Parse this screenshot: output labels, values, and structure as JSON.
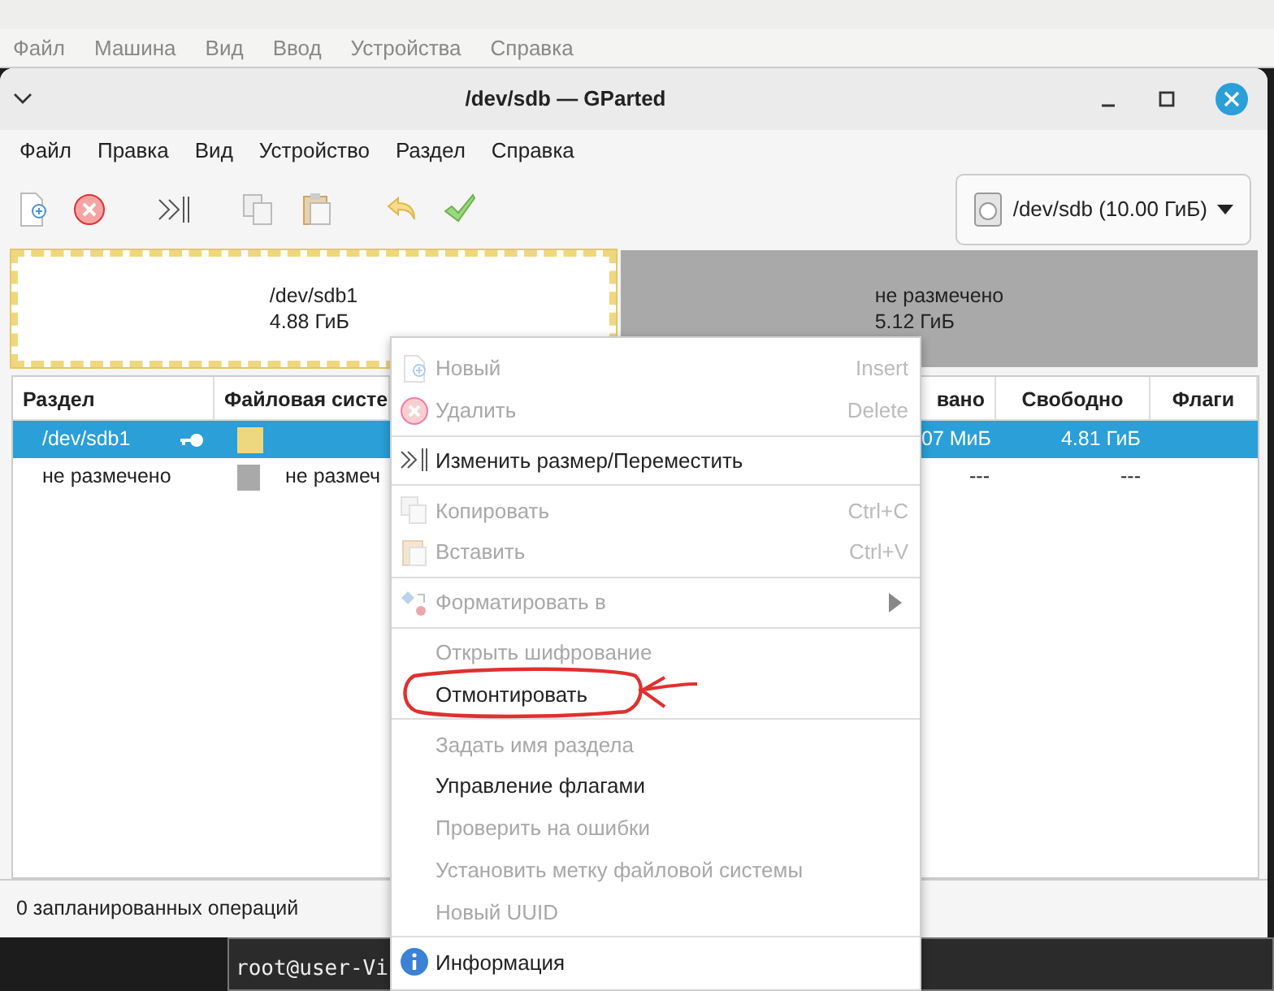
{
  "host_menu": [
    {
      "label": "Файл"
    },
    {
      "label": "Машина"
    },
    {
      "label": "Вид"
    },
    {
      "label": "Ввод"
    },
    {
      "label": "Устройства"
    },
    {
      "label": "Справка"
    }
  ],
  "window": {
    "title": "/dev/sdb — GParted"
  },
  "menu": [
    {
      "label": "Файл"
    },
    {
      "label": "Правка"
    },
    {
      "label": "Вид"
    },
    {
      "label": "Устройство"
    },
    {
      "label": "Раздел"
    },
    {
      "label": "Справка"
    }
  ],
  "device": {
    "label": "/dev/sdb (10.00 ГиБ)"
  },
  "disk_map": [
    {
      "kind": "partition",
      "name": "/dev/sdb1",
      "size": "4.88 ГиБ",
      "selected": true
    },
    {
      "kind": "unallocated",
      "name": "не размечено",
      "size": "5.12 ГиБ",
      "selected": false
    }
  ],
  "table": {
    "columns": [
      "Раздел",
      "Файловая систе",
      "вано",
      "Свободно",
      "Флаги"
    ],
    "rows": [
      {
        "partition": "/dev/sdb1",
        "mounted": true,
        "color": "#efd77f",
        "filesystem": "",
        "used": "07 МиБ",
        "free": "4.81 ГиБ",
        "selected": true
      },
      {
        "partition": "не размечено",
        "mounted": false,
        "color": "#a9a9a9",
        "filesystem": "не размеч",
        "used": "---",
        "free": "---",
        "selected": false
      }
    ]
  },
  "status_bar": "0 запланированных операций",
  "terminal": {
    "text": "root@user-Vi"
  },
  "context_menu": [
    {
      "kind": "item",
      "label": "Новый",
      "shortcut": "Insert",
      "disabled": true
    },
    {
      "kind": "item",
      "label": "Удалить",
      "shortcut": "Delete",
      "disabled": true
    },
    {
      "kind": "separator"
    },
    {
      "kind": "item",
      "label": "Изменить размер/Переместить",
      "disabled": false
    },
    {
      "kind": "separator"
    },
    {
      "kind": "item",
      "label": "Копировать",
      "shortcut": "Ctrl+C",
      "disabled": true
    },
    {
      "kind": "item",
      "label": "Вставить",
      "shortcut": "Ctrl+V",
      "disabled": true
    },
    {
      "kind": "separator"
    },
    {
      "kind": "item",
      "label": "Форматировать в",
      "disabled": true,
      "submenu": true
    },
    {
      "kind": "separator"
    },
    {
      "kind": "item",
      "label": "Открыть шифрование",
      "disabled": true
    },
    {
      "kind": "item",
      "label": "Отмонтировать",
      "disabled": false,
      "highlighted": true
    },
    {
      "kind": "separator"
    },
    {
      "kind": "item",
      "label": "Задать имя раздела",
      "disabled": true
    },
    {
      "kind": "item",
      "label": "Управление флагами",
      "disabled": false
    },
    {
      "kind": "item",
      "label": "Проверить на ошибки",
      "disabled": true
    },
    {
      "kind": "item",
      "label": "Установить метку файловой системы",
      "disabled": true
    },
    {
      "kind": "item",
      "label": "Новый UUID",
      "disabled": true
    },
    {
      "kind": "separator"
    },
    {
      "kind": "item",
      "label": "Информация",
      "disabled": false
    }
  ]
}
